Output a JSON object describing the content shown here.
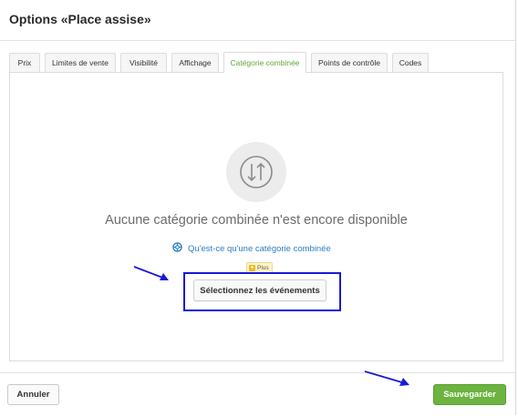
{
  "dialog": {
    "title": "Options «Place assise»"
  },
  "tabs": [
    {
      "label": "Prix",
      "active": false
    },
    {
      "label": "Limites de vente",
      "active": false
    },
    {
      "label": "Visibilité",
      "active": false
    },
    {
      "label": "Affichage",
      "active": false
    },
    {
      "label": "Catégorie combinée",
      "active": true
    },
    {
      "label": "Points de contrôle",
      "active": false
    },
    {
      "label": "Codes",
      "active": false
    }
  ],
  "empty_state": {
    "icon": "swap-vertical-icon",
    "message": "Aucune catégorie combinée n'est encore disponible",
    "help_icon": "lifebuoy-icon",
    "help_link": "Qu'est-ce qu'une catégorie combinée",
    "badge_label": "Plus",
    "button_label": "Sélectionnez les événements"
  },
  "footer": {
    "cancel_label": "Annuler",
    "save_label": "Sauvegarder"
  },
  "colors": {
    "accent_green": "#6cb33f",
    "active_tab_text": "#61a83c",
    "link_blue": "#2a7fc1",
    "annotation_blue": "#1a1ad6"
  }
}
